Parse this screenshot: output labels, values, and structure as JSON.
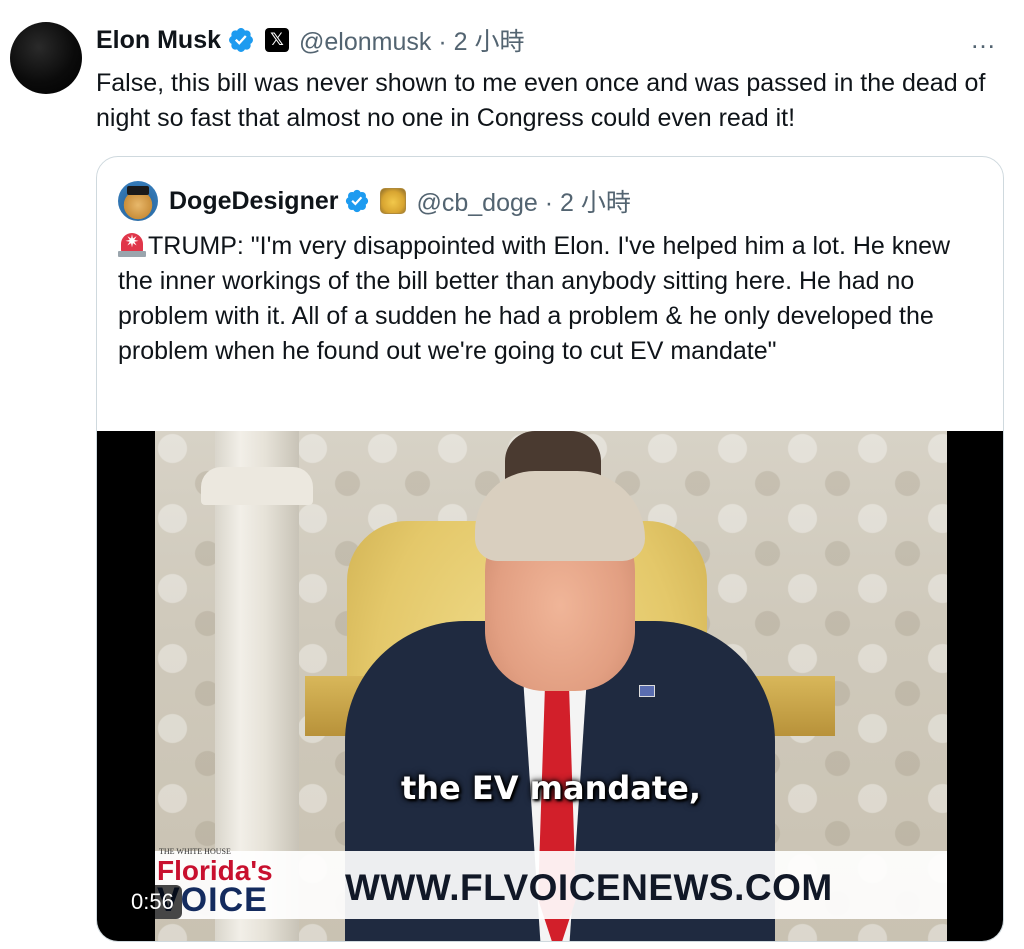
{
  "tweet": {
    "author_name": "Elon Musk",
    "handle_time": "@elonmusk · 2 小時",
    "more_icon": "…",
    "text": "False, this bill was never shown to me even once and was passed in the dead of night so fast that almost no one in Congress could even read it!",
    "verified_color": "#1d9bf0"
  },
  "quote": {
    "author_name": "DogeDesigner",
    "handle_time": "@cb_doge · 2 小時",
    "alarm_icon": "✷",
    "text": "TRUMP: \"I'm very disappointed with Elon. I've helped him a lot. He knew the inner workings of the bill better than anybody sitting here. He had no problem with it. All of a sudden he had a problem & he only developed the problem when he found out we're going to cut EV mandate\""
  },
  "video": {
    "caption": "the EV mandate,",
    "watermark_small": "THE WHITE HOUSE",
    "logo_line1": "Florida's",
    "logo_line2": "VOICE",
    "site_url": "WWW.FLVOICENEWS.COM",
    "duration": "0:56"
  }
}
